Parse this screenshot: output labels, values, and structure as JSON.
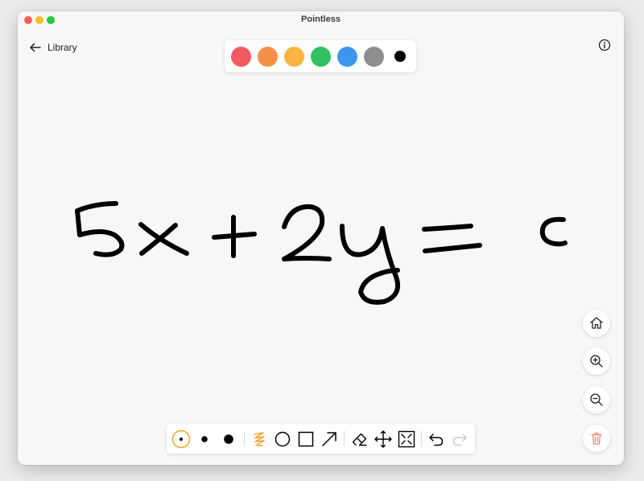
{
  "window": {
    "title": "Pointless"
  },
  "nav": {
    "back_label": "Library"
  },
  "palette": {
    "colors": [
      {
        "name": "red",
        "hex": "#f25a61"
      },
      {
        "name": "orange",
        "hex": "#f59049"
      },
      {
        "name": "yellow",
        "hex": "#f8b640"
      },
      {
        "name": "green",
        "hex": "#31c163"
      },
      {
        "name": "blue",
        "hex": "#3b96ec"
      },
      {
        "name": "gray",
        "hex": "#8e8e8e"
      },
      {
        "name": "black",
        "hex": "#000000"
      }
    ]
  },
  "canvas": {
    "ink_color": "#000000",
    "content": "handwritten equation 5x + 2y = c"
  },
  "zoom_controls": [
    "home-icon",
    "zoom-in-icon",
    "zoom-out-icon",
    "trash-icon"
  ],
  "toolbar": {
    "accent": "#f0a52c",
    "tools": [
      "small-brush-icon",
      "medium-brush-icon",
      "large-brush-icon",
      "pen-icon",
      "circle-icon",
      "rectangle-icon",
      "arrow-icon",
      "eraser-icon",
      "move-icon",
      "fit-screen-icon",
      "undo-icon",
      "redo-icon"
    ],
    "selected": "small-brush-icon",
    "redo_enabled": false
  },
  "colors": {
    "trash": "#f08080",
    "disabled": "#c8c8c8"
  }
}
